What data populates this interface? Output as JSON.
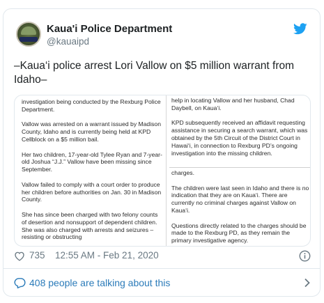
{
  "account": {
    "name": "Kaua'i Police Department",
    "handle": "@kauaipd",
    "avatar_badge_text": "POLICE"
  },
  "tweet": {
    "text": "–Kaua‘i police arrest Lori Vallow on $5 million warrant from Idaho–"
  },
  "media": {
    "left_column": [
      "investigation being conducted by the Rexburg Police Department.",
      "Vallow was arrested on a warrant issued by Madison County, Idaho and is currently being held at KPD Cellblock on a $5 million bail.",
      "Her two children, 17-year-old Tylee Ryan and 7-year-old Joshua “J.J.” Vallow have been missing since September.",
      "Vallow failed to comply with a court order to produce her children before authorities on Jan. 30 in Madison County.",
      "She has since been charged with two felony counts of desertion and nonsupport of dependent children. She was also charged with arrests and seizures – resisting or obstructing"
    ],
    "right_column_top": [
      "help in locating Vallow and her husband, Chad Daybell, on Kaua‘i.",
      "KPD subsequently received an affidavit requesting assistance in securing a search warrant, which was obtained by the 5th Circuit of the District Court in Hawai‘i, in connection to Rexburg PD’s ongoing investigation into the missing children."
    ],
    "right_column_bottom": [
      "charges.",
      "The children were last seen in Idaho and there is no indication that they are on Kaua‘i. There are currently no criminal charges against Vallow on Kaua‘i.",
      "Questions directly related to the charges should be made to the Rexburg PD, as they remain the primary investigative agency."
    ]
  },
  "meta": {
    "likes": "735",
    "timestamp": "12:55 AM - Feb 21, 2020"
  },
  "footer": {
    "talking": "408 people are talking about this"
  },
  "icons": {
    "brand": "twitter-bird-icon",
    "like": "heart-icon",
    "info": "info-icon",
    "reply": "speech-bubble-icon",
    "more": "chevron-right-icon"
  },
  "colors": {
    "twitter_blue": "#1da1f2",
    "link_blue": "#2b7bb9",
    "muted_gray": "#697882",
    "border": "#e1e8ed"
  }
}
